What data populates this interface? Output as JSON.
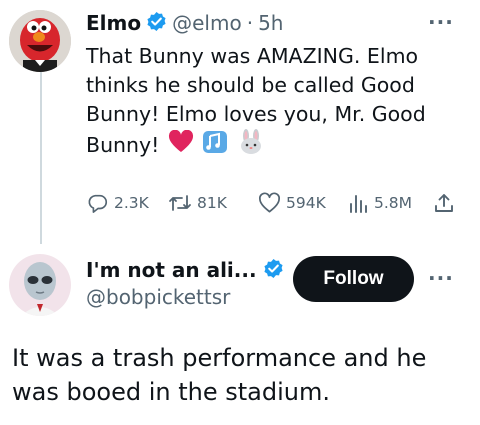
{
  "tweet": {
    "author_name": "Elmo",
    "handle": "@elmo",
    "separator": "·",
    "time": "5h",
    "more": "···",
    "text": "That Bunny was AMAZING. Elmo thinks he should be called Good Bunny! Elmo loves you, Mr. Good Bunny!",
    "emojis": [
      "red-heart",
      "musical-notes",
      "rabbit-face"
    ],
    "stats": {
      "replies": "2.3K",
      "reposts": "81K",
      "likes": "594K",
      "views": "5.8M"
    }
  },
  "reply": {
    "author_name": "I'm not an ali...",
    "handle": "@bobpickettsr",
    "follow_label": "Follow",
    "more": "···",
    "text": "It was a trash performance and he was booed in the stadium."
  },
  "colors": {
    "verified_blue": "#1d9bf0",
    "muted_text": "#536471",
    "follow_bg": "#0f1419",
    "heart_red": "#e0245e",
    "note_blue": "#5aa9e6"
  }
}
